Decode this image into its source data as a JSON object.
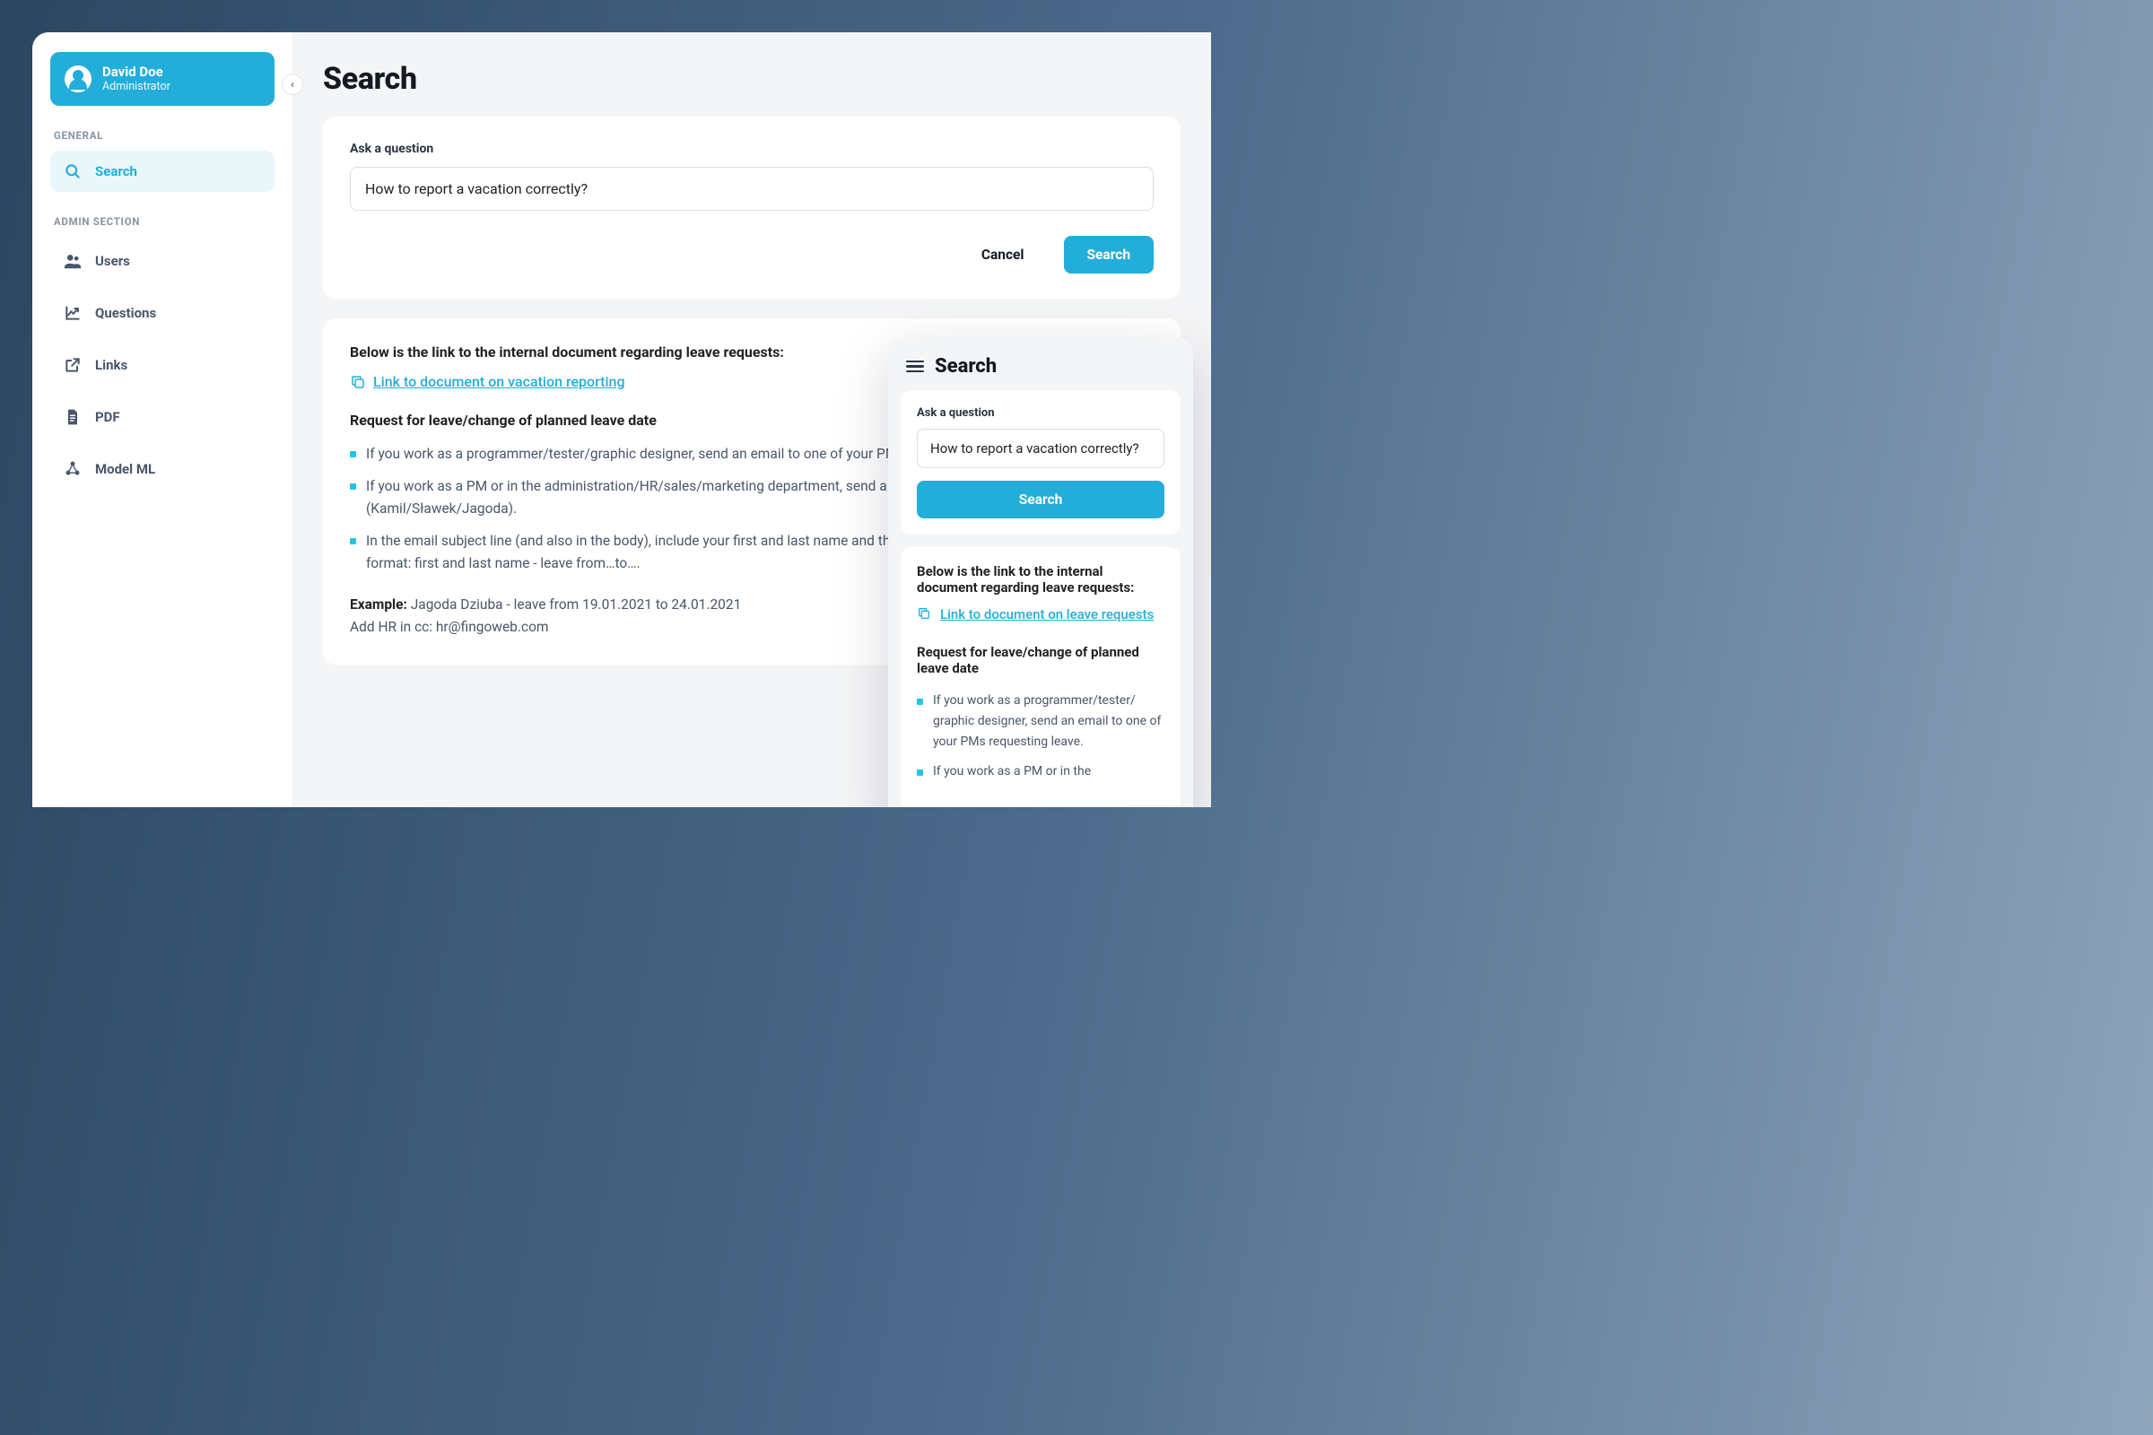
{
  "user": {
    "name": "David Doe",
    "role": "Administrator"
  },
  "sidebar": {
    "section_general": "GENERAL",
    "section_admin": "ADMIN SECTION",
    "items_general": [
      {
        "label": "Search"
      }
    ],
    "items_admin": [
      {
        "label": "Users"
      },
      {
        "label": "Questions"
      },
      {
        "label": "Links"
      },
      {
        "label": "PDF"
      },
      {
        "label": "Model ML"
      }
    ]
  },
  "page": {
    "title": "Search"
  },
  "ask": {
    "label": "Ask a question",
    "value": "How to report a vacation correctly?",
    "cancel": "Cancel",
    "search": "Search"
  },
  "result": {
    "intro": "Below is the link to the internal document regarding leave requests:",
    "link_text": "Link to document on vacation reporting",
    "section_title": "Request for leave/change of planned leave date",
    "bullets": [
      "If you work as a programmer/tester/graphic designer, send an email to one of your PMs requesting leave.",
      "If you work as a PM or in the administration/HR/sales/marketing department, send a leave request to your direct supervisor (Kamil/Sławek/Jagoda).",
      "In the email subject line (and also in the body), include your first and last name and the planned leave dates following the format: first and last name - leave from…to…."
    ],
    "example_label": "Example:",
    "example_text": "Jagoda Dziuba - leave from 19.01.2021 to 24.01.2021",
    "cc_line": "Add HR in cc: hr@fingoweb.com"
  },
  "mobile": {
    "title": "Search",
    "ask_label": "Ask a question",
    "ask_value": "How to report a vacation correctly?",
    "search": "Search",
    "intro": "Below is the link to the internal document regarding leave requests:",
    "link_text": "Link to document on leave requests",
    "section_title": "Request for leave/change of planned leave date",
    "bullets": [
      "If you work as a programmer/tester/ graphic designer, send an email to one of your PMs requesting leave.",
      "If you work as a PM or in the"
    ]
  }
}
